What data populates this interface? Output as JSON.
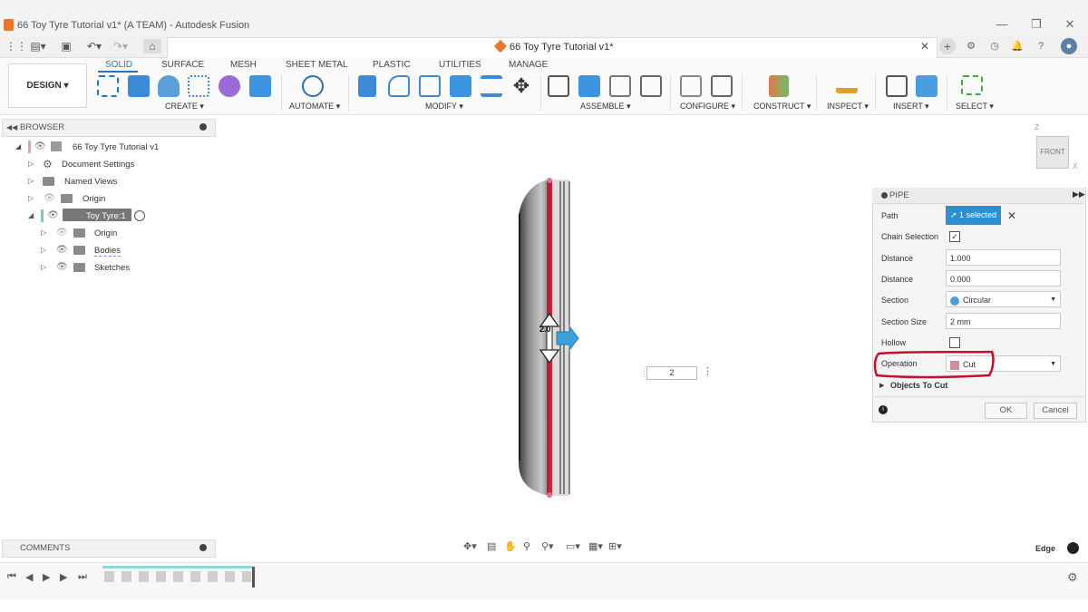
{
  "window": {
    "title": "66 Toy Tyre Tutorial v1* (A TEAM) - Autodesk Fusion",
    "minimize": "—",
    "restore": "❐",
    "close": "✕"
  },
  "tabs": {
    "document_tab": "66 Toy Tyre Tutorial v1*",
    "close": "✕",
    "new_tab": "+"
  },
  "ribbon": {
    "workspace": "DESIGN ▾",
    "tabs": [
      "SOLID",
      "SURFACE",
      "MESH",
      "SHEET METAL",
      "PLASTIC",
      "UTILITIES",
      "MANAGE"
    ],
    "groups": [
      "CREATE ▾",
      "AUTOMATE ▾",
      "MODIFY ▾",
      "ASSEMBLE ▾",
      "CONFIGURE ▾",
      "CONSTRUCT ▾",
      "INSPECT ▾",
      "INSERT ▾",
      "SELECT ▾"
    ]
  },
  "browser": {
    "title": "BROWSER",
    "root": "66 Toy Tyre Tutorial v1",
    "items": [
      "Document Settings",
      "Named Views",
      "Origin",
      "Toy Tyre:1",
      "Origin",
      "Bodies",
      "Sketches"
    ]
  },
  "viewcube": {
    "face": "FRONT",
    "z": "Z",
    "x": "X"
  },
  "dimension": {
    "value": "2",
    "manip_label": "2.0"
  },
  "pipe": {
    "title": "PIPE",
    "rows": {
      "path_label": "Path",
      "path_value": "1 selected",
      "chain_label": "Chain Selection",
      "chain_checked": true,
      "distance1_label": "Distance",
      "distance1_value": "1.000",
      "distance2_label": "Distance",
      "distance2_value": "0.000",
      "section_label": "Section",
      "section_value": "Circular",
      "section_size_label": "Section Size",
      "section_size_value": "2 mm",
      "hollow_label": "Hollow",
      "hollow_checked": false,
      "operation_label": "Operation",
      "operation_value": "Cut",
      "objects_label": "Objects To Cut"
    },
    "ok": "OK",
    "cancel": "Cancel",
    "accent": "#2b8fd2",
    "highlight": "#c0122d"
  },
  "comments": {
    "title": "COMMENTS"
  },
  "status": {
    "selection_filter": "Edge"
  }
}
